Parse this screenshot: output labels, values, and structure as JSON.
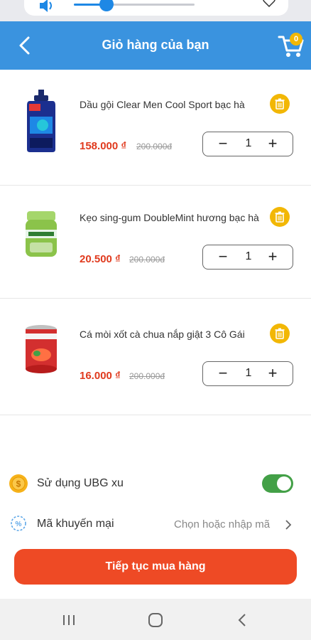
{
  "header": {
    "title": "Giỏ hàng của bạn",
    "cart_count": "0"
  },
  "items": [
    {
      "name": "Dầu gội Clear Men Cool Sport bạc hà",
      "price": "158.000 ₫",
      "old_price": "200.000đ",
      "qty": "1",
      "image": "shampoo-bottle"
    },
    {
      "name": "Kẹo sing-gum DoubleMint hương bạc hà",
      "price": "20.500 ₫",
      "old_price": "200.000đ",
      "qty": "1",
      "image": "gum-jar"
    },
    {
      "name": "Cá mòi xốt cà chua nắp giật 3 Cô Gái",
      "price": "16.000 ₫",
      "old_price": "200.000đ",
      "qty": "1",
      "image": "sardine-can"
    }
  ],
  "qty_controls": {
    "minus": "−",
    "plus": "+"
  },
  "coin": {
    "label": "Sử dụng UBG xu",
    "enabled": true
  },
  "promo": {
    "label": "Mã khuyến mại",
    "placeholder": "Chọn hoặc nhập mã"
  },
  "cta": {
    "label": "Tiếp tục mua hàng"
  },
  "colors": {
    "header": "#3a93df",
    "accent": "#ee4a25",
    "price": "#e03a1e",
    "toggle_on": "#43a047",
    "badge": "#f2b705"
  },
  "volume": {
    "level": 0.27
  }
}
